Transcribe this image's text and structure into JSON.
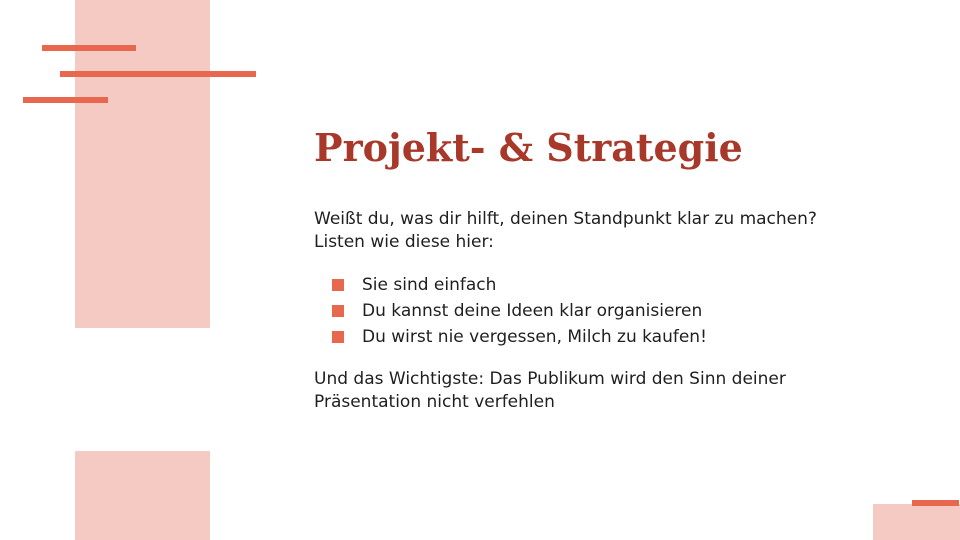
{
  "slide": {
    "title": "Projekt- & Strategie",
    "intro_line1": "Weißt du, was dir hilft, deinen Standpunkt klar zu machen?",
    "intro_line2": "Listen wie diese hier:",
    "bullets": [
      "Sie sind einfach",
      "Du kannst deine Ideen klar organisieren",
      "Du wirst nie vergessen, Milch zu kaufen!"
    ],
    "conclusion": "Und das Wichtigste: Das Publikum wird den Sinn deiner Präsentation nicht verfehlen"
  },
  "colors": {
    "title": "#a8382a",
    "accent": "#e8674f",
    "accent_light": "#f5cac2",
    "text": "#1f1f1f"
  }
}
